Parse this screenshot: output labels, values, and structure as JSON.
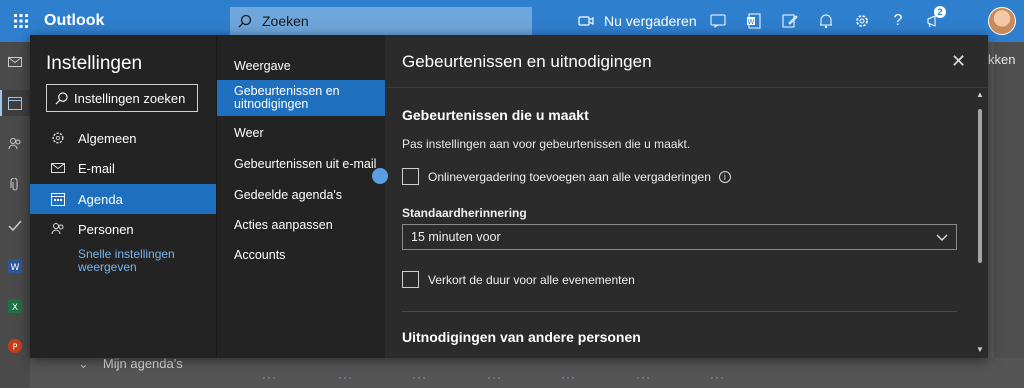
{
  "app": {
    "title": "Outlook"
  },
  "search": {
    "placeholder": "Zoeken"
  },
  "topbar": {
    "meet_now": "Nu vergaderen",
    "notification_count": "2",
    "icons": [
      "teams-icon",
      "word-icon",
      "edit-icon",
      "bell-icon",
      "gear-icon",
      "help-icon",
      "megaphone-icon"
    ]
  },
  "background": {
    "right_text": "kken",
    "bottom_text": "Mijn agenda's"
  },
  "settings": {
    "title": "Instellingen",
    "search_placeholder": "Instellingen zoeken",
    "categories": [
      {
        "label": "Algemeen",
        "icon": "gear-icon"
      },
      {
        "label": "E-mail",
        "icon": "mail-icon"
      },
      {
        "label": "Agenda",
        "icon": "calendar-icon",
        "selected": true
      },
      {
        "label": "Personen",
        "icon": "people-icon"
      }
    ],
    "quick_settings": "Snelle instellingen weergeven",
    "subcategories": [
      {
        "label": "Weergave"
      },
      {
        "label": "Gebeurtenissen en uitnodigingen",
        "selected": true
      },
      {
        "label": "Weer"
      },
      {
        "label": "Gebeurtenissen uit e-mail"
      },
      {
        "label": "Gedeelde agenda's"
      },
      {
        "label": "Acties aanpassen"
      },
      {
        "label": "Accounts"
      }
    ]
  },
  "panel": {
    "title": "Gebeurtenissen en uitnodigingen",
    "section1_heading": "Gebeurtenissen die u maakt",
    "section1_desc": "Pas instellingen aan voor gebeurtenissen die u maakt.",
    "online_meeting_label": "Onlinevergadering toevoegen aan alle vergaderingen",
    "online_meeting_checked": false,
    "reminder_label": "Standaardherinnering",
    "reminder_value": "15 minuten voor",
    "shorten_label": "Verkort de duur voor alle evenementen",
    "shorten_checked": false,
    "section2_heading": "Uitnodigingen van andere personen"
  },
  "colors": {
    "topbar": "#2f7fcf",
    "selected": "#1f6fbf",
    "dialog_bg": "#2b2b2b",
    "link": "#7ab3ee"
  }
}
